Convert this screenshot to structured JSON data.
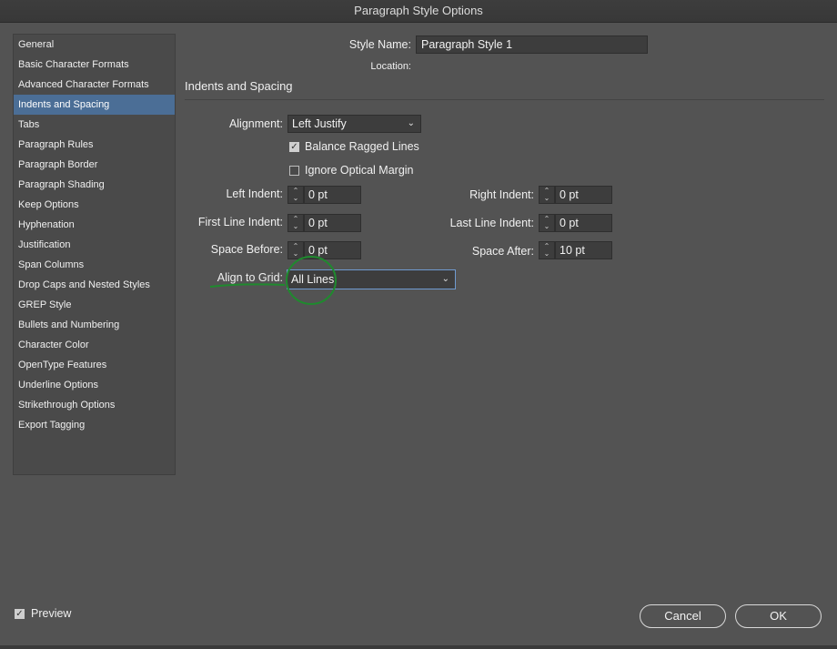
{
  "window": {
    "title": "Paragraph Style Options"
  },
  "sidebar": {
    "items": [
      {
        "label": "General"
      },
      {
        "label": "Basic Character Formats"
      },
      {
        "label": "Advanced Character Formats"
      },
      {
        "label": "Indents and Spacing",
        "selected": true
      },
      {
        "label": "Tabs"
      },
      {
        "label": "Paragraph Rules"
      },
      {
        "label": "Paragraph Border"
      },
      {
        "label": "Paragraph Shading"
      },
      {
        "label": "Keep Options"
      },
      {
        "label": "Hyphenation"
      },
      {
        "label": "Justification"
      },
      {
        "label": "Span Columns"
      },
      {
        "label": "Drop Caps and Nested Styles"
      },
      {
        "label": "GREP Style"
      },
      {
        "label": "Bullets and Numbering"
      },
      {
        "label": "Character Color"
      },
      {
        "label": "OpenType Features"
      },
      {
        "label": "Underline Options"
      },
      {
        "label": "Strikethrough Options"
      },
      {
        "label": "Export Tagging"
      }
    ]
  },
  "header": {
    "style_name_label": "Style Name:",
    "style_name_value": "Paragraph Style 1",
    "location_label": "Location:",
    "section_title": "Indents and Spacing"
  },
  "form": {
    "alignment_label": "Alignment:",
    "alignment_value": "Left Justify",
    "balance_label": "Balance Ragged Lines",
    "balance_checked": true,
    "optical_label": "Ignore Optical Margin",
    "optical_checked": false,
    "left_indent_label": "Left Indent:",
    "left_indent_value": "0 pt",
    "right_indent_label": "Right Indent:",
    "right_indent_value": "0 pt",
    "first_line_label": "First Line Indent:",
    "first_line_value": "0 pt",
    "last_line_label": "Last Line Indent:",
    "last_line_value": "0 pt",
    "space_before_label": "Space Before:",
    "space_before_value": "0 pt",
    "space_after_label": "Space After:",
    "space_after_value": "10 pt",
    "align_grid_label": "Align to Grid:",
    "align_grid_value": "All Lines"
  },
  "footer": {
    "preview_label": "Preview",
    "preview_checked": true,
    "cancel_label": "Cancel",
    "ok_label": "OK"
  },
  "colors": {
    "accent": "#4b6e96",
    "annotation": "#1f8a2e"
  },
  "icons": {
    "stepper": "up-down-arrows-icon",
    "dropdown": "chevron-down-icon",
    "check": "checkmark-icon"
  }
}
